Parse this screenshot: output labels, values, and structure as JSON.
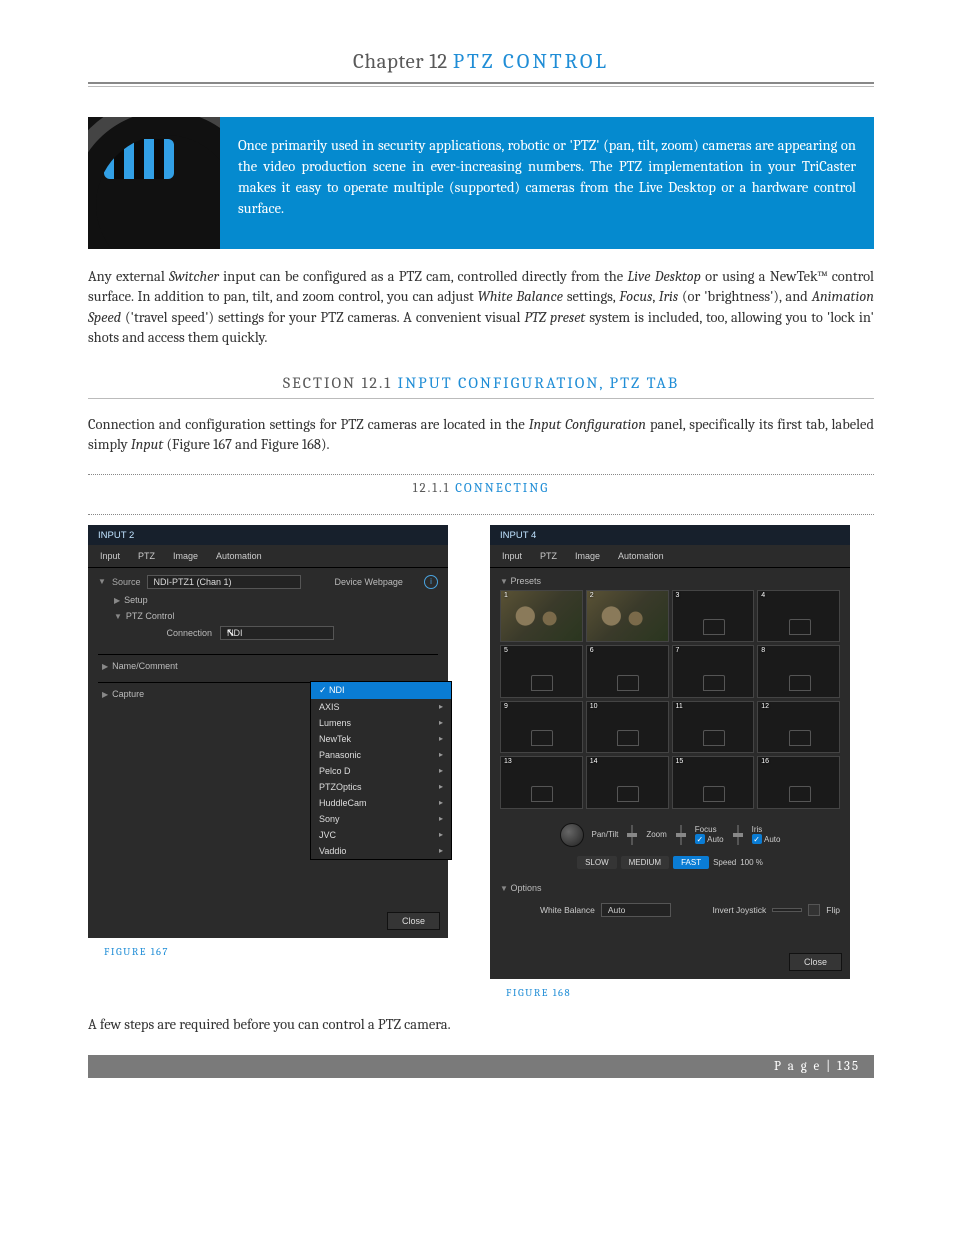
{
  "chapter": {
    "prefix": "Chapter 12",
    "title": "PTZ CONTROL"
  },
  "intro_box": "Once primarily used in security applications, robotic or 'PTZ' (pan, tilt, zoom) cameras are appearing on the video production scene in ever-increasing numbers.  The PTZ implementation in your TriCaster makes it easy to operate multiple (supported) cameras from the Live Desktop or a hardware control surface.",
  "para1": {
    "t1": "Any external ",
    "i1": "Switcher",
    "t2": " input can be configured as a PTZ cam, controlled directly from the ",
    "i2": "Live Desktop",
    "t3": " or using a NewTek™ control surface.  In addition to pan, tilt, and zoom control, you can adjust ",
    "i3": "White Balance",
    "t4": " settings, ",
    "i4": "Focus",
    "t5": ", ",
    "i5": "Iris",
    "t6": " (or 'brightness'), and ",
    "i6": "Animation Speed",
    "t7": " ('travel speed') settings for your PTZ cameras.   A convenient visual ",
    "i7": "PTZ preset",
    "t8": " system is included, too, allowing you to 'lock in' shots and access them quickly."
  },
  "section": {
    "prefix": "SECTION 12.1",
    "title": "INPUT CONFIGURATION, PTZ TAB"
  },
  "para2": {
    "t1": "Connection and configuration settings for PTZ cameras are located in the ",
    "i1": "Input Configuration",
    "t2": " panel, specifically its first tab, labeled simply ",
    "i2": "Input",
    "t3": " (Figure 167 and Figure 168)."
  },
  "subsection": {
    "prefix": "12.1.1",
    "title": "CONNECTING"
  },
  "figure167": {
    "header": "INPUT 2",
    "tabs": [
      "Input",
      "PTZ",
      "Image",
      "Automation"
    ],
    "source_label": "Source",
    "source_value": "NDI-PTZ1 (Chan 1)",
    "device_webpage": "Device Webpage",
    "setup": "Setup",
    "ptz_control": "PTZ Control",
    "connection_label": "Connection",
    "connection_value": "NDI",
    "name_comment": "Name/Comment",
    "capture": "Capture",
    "dropdown": [
      "NDI",
      "AXIS",
      "Lumens",
      "NewTek",
      "Panasonic",
      "Pelco D",
      "PTZOptics",
      "HuddleCam",
      "Sony",
      "JVC",
      "Vaddio"
    ],
    "close": "Close",
    "caption": "FIGURE 167"
  },
  "figure168": {
    "header": "INPUT 4",
    "tabs": [
      "Input",
      "PTZ",
      "Image",
      "Automation"
    ],
    "presets_label": "Presets",
    "preset_numbers": [
      "1",
      "2",
      "3",
      "4",
      "5",
      "6",
      "7",
      "8",
      "9",
      "10",
      "11",
      "12",
      "13",
      "14",
      "15",
      "16"
    ],
    "controls": {
      "pantilt": "Pan/Tilt",
      "zoom": "Zoom",
      "focus": "Focus",
      "auto1": "Auto",
      "iris": "Iris",
      "auto2": "Auto"
    },
    "speeds": {
      "slow": "SLOW",
      "medium": "MEDIUM",
      "fast": "FAST",
      "label": "Speed",
      "value": "100 %"
    },
    "options_label": "Options",
    "wb_label": "White Balance",
    "wb_value": "Auto",
    "invert_joystick": "Invert Joystick",
    "flip": "Flip",
    "close": "Close",
    "caption": "FIGURE 168"
  },
  "para3": "A few steps are required before you can control a PTZ camera.",
  "footer": "P a g e  | 135"
}
